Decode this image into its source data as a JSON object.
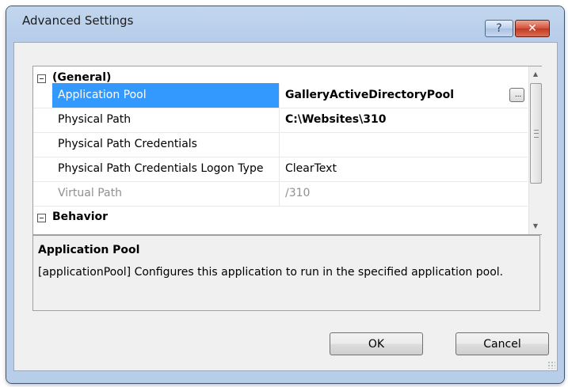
{
  "window": {
    "title": "Advanced Settings",
    "help_label": "?",
    "close_label": "✕"
  },
  "property_grid": {
    "categories": [
      {
        "label": "(General)",
        "expanded": true
      },
      {
        "label": "Behavior",
        "expanded": true
      }
    ],
    "rows": [
      {
        "name": "Application Pool",
        "value": "GalleryActiveDirectoryPool",
        "selected": true,
        "bold": true,
        "has_ellipsis": true
      },
      {
        "name": "Physical Path",
        "value": "C:\\Websites\\310",
        "bold": true
      },
      {
        "name": "Physical Path Credentials",
        "value": ""
      },
      {
        "name": "Physical Path Credentials Logon Type",
        "value": "ClearText"
      },
      {
        "name": "Virtual Path",
        "value": "/310",
        "disabled": true
      }
    ],
    "ellipsis_label": "..."
  },
  "description": {
    "title": "Application Pool",
    "text": "[applicationPool] Configures this application to run in the specified application pool."
  },
  "buttons": {
    "ok": "OK",
    "cancel": "Cancel"
  },
  "colors": {
    "selection": "#3399ff",
    "frame": "#b9cee9",
    "dialog_background": "#f0f0f0"
  }
}
